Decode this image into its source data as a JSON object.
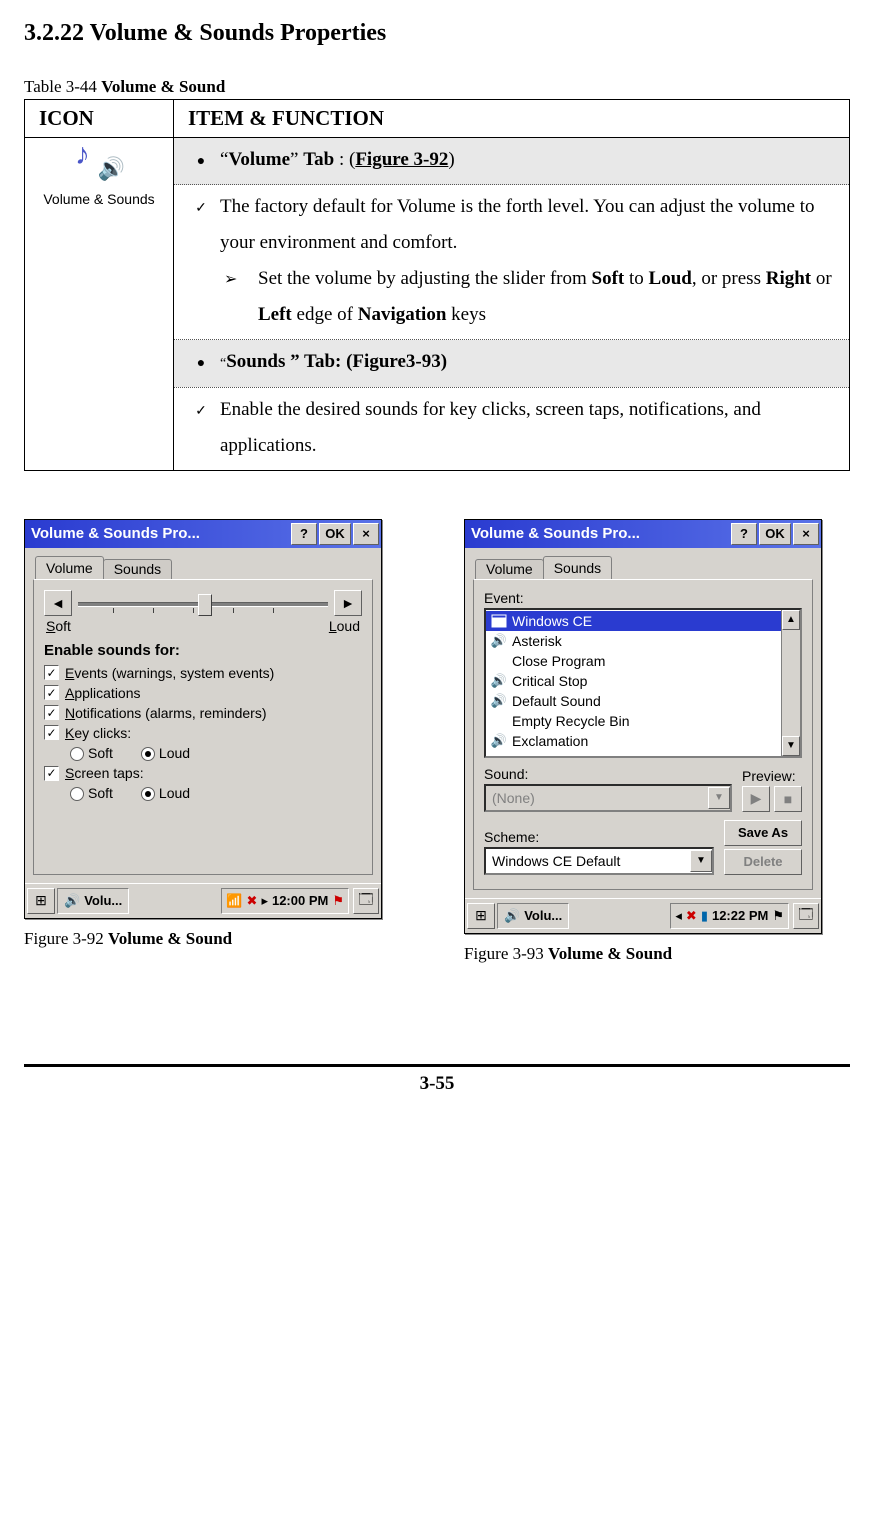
{
  "heading": "3.2.22 Volume & Sounds Properties",
  "table_caption_prefix": "Table 3-44 ",
  "table_caption_bold": "Volume & Sound",
  "th_icon": "ICON",
  "th_item": "ITEM & FUNCTION",
  "icon_label": "Volume & Sounds",
  "row1_before": "“",
  "row1_bold1": "Volume",
  "row1_mid": "” ",
  "row1_bold2": "Tab",
  "row1_after": " : (",
  "row1_link": "Figure 3-92",
  "row1_close": ")",
  "row2_text": "The factory default for Volume is the forth level. You can adjust the volume to your environment and comfort.",
  "row2_sub_before": "Set the volume by adjusting the slider from ",
  "row2_sub_soft": "Soft",
  "row2_sub_to": " to ",
  "row2_sub_loud": "Loud",
  "row2_sub_after1": ", or press ",
  "row2_sub_right": "Right",
  "row2_sub_or": " or ",
  "row2_sub_left": "Left",
  "row2_sub_after2": " edge of ",
  "row2_sub_nav": "Navigation",
  "row2_sub_after3": " keys",
  "row3_before": "“",
  "row3_bold": "Sounds ” Tab: (Figure3-93)",
  "row4_text": "Enable the desired sounds for key clicks, screen taps, notifications, and applications.",
  "dlg_title": "Volume & Sounds Pro...",
  "btn_help": "?",
  "btn_ok": "OK",
  "btn_close": "×",
  "tab_volume": "Volume",
  "tab_sounds": "Sounds",
  "slider_soft": "Soft",
  "slider_loud": "Loud",
  "enable_label": "Enable sounds for:",
  "chk_events": "Events (warnings, system events)",
  "chk_apps": "Applications",
  "chk_notif": "Notifications (alarms, reminders)",
  "chk_key": "Key clicks:",
  "chk_screen": "Screen taps:",
  "radio_soft": "Soft",
  "radio_loud": "Loud",
  "event_label": "Event:",
  "events": [
    "Windows CE",
    "Asterisk",
    "Close Program",
    "Critical Stop",
    "Default Sound",
    "Empty Recycle Bin",
    "Exclamation"
  ],
  "sound_label": "Sound:",
  "sound_value": "(None)",
  "preview_label": "Preview:",
  "scheme_label": "Scheme:",
  "scheme_value": "Windows CE Default",
  "saveas": "Save As",
  "delete": "Delete",
  "task_text": "Volu...",
  "clock1": "12:00 PM",
  "clock2": "12:22 PM",
  "tray_arrow": "▸",
  "fig1_prefix": "Figure 3-92 ",
  "fig1_bold": "Volume & Sound",
  "fig2_prefix": "Figure 3-93 ",
  "fig2_bold": "Volume & Sound",
  "page_num": "3-55"
}
